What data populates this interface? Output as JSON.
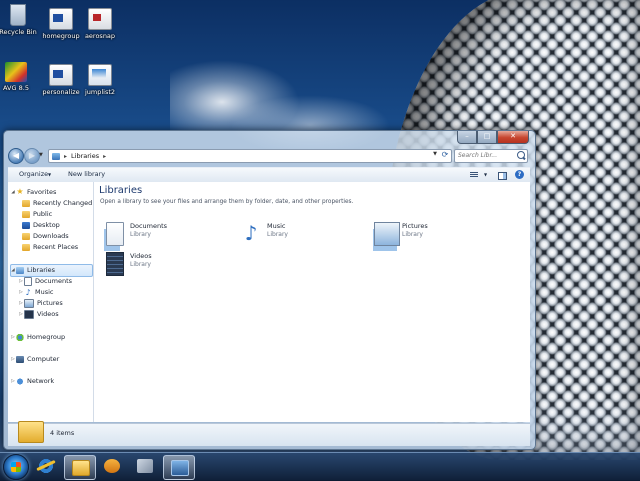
{
  "desktop": {
    "icons": [
      {
        "label": "Recycle Bin"
      },
      {
        "label": "homegroup"
      },
      {
        "label": "aerosnap"
      },
      {
        "label": "AVG 8.5"
      },
      {
        "label": "personalize"
      },
      {
        "label": "jumplist2"
      }
    ]
  },
  "window": {
    "caption_buttons": {
      "minimize": "–",
      "maximize": "□",
      "close": "✕"
    },
    "address": {
      "root": "Libraries"
    },
    "search": {
      "placeholder": "Search Libr..."
    },
    "toolbar": {
      "organize": "Organize",
      "new_library": "New library",
      "help": "?"
    },
    "nav_pane": {
      "favorites": "Favorites",
      "favorites_items": [
        "Recently Changed",
        "Public",
        "Desktop",
        "Downloads",
        "Recent Places"
      ],
      "libraries": "Libraries",
      "libraries_items": [
        "Documents",
        "Music",
        "Pictures",
        "Videos"
      ],
      "homegroup": "Homegroup",
      "computer": "Computer",
      "network": "Network"
    },
    "content": {
      "title": "Libraries",
      "subtitle": "Open a library to see your files and arrange them by folder, date, and other properties.",
      "libraries": [
        {
          "name": "Documents",
          "type": "Library"
        },
        {
          "name": "Music",
          "type": "Library"
        },
        {
          "name": "Pictures",
          "type": "Library"
        },
        {
          "name": "Videos",
          "type": "Library"
        }
      ]
    },
    "details": {
      "item_count": "4 items"
    }
  }
}
